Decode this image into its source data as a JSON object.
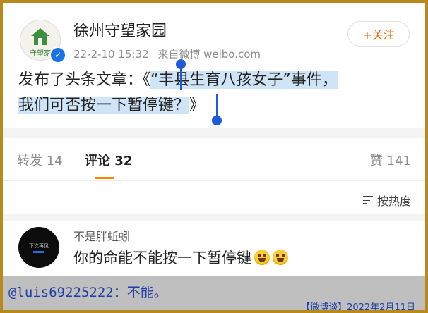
{
  "post": {
    "username": "徐州守望家园",
    "avatar_text": "守望家",
    "timestamp": "22-2-10 15:32",
    "source": "来自微博 weibo.com",
    "follow_label": "+关注",
    "article_prefix": "发布了头条文章：《",
    "article_title_line1": "“丰县生育八孩女子”事件，",
    "article_title_line2": "我们可否按一下暂停键？",
    "article_suffix": "》"
  },
  "tabs": {
    "repost": "转发 14",
    "comments": "评论 32",
    "likes": "赞 141"
  },
  "sort": {
    "label": "按热度"
  },
  "comment": {
    "avatar_text": "下次再见",
    "user": "不是胖蚯蚓",
    "text": "你的命能不能按一下暂停键"
  },
  "caption": {
    "text": "@luis69225222：不能。",
    "source": "【微博谈】2022年2月11日"
  },
  "colors": {
    "border": "#b88a1d",
    "accent": "#ff8200",
    "highlight": "#cfe4f7",
    "selection_handle": "#1d5bd8",
    "caption_text": "#1f3ea6"
  }
}
